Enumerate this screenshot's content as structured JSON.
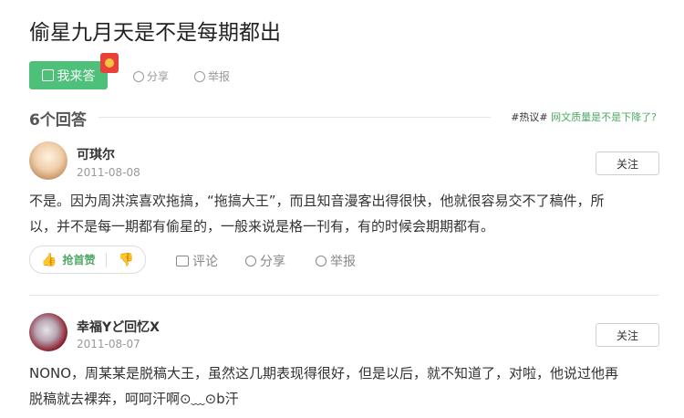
{
  "question": {
    "title": "偷星九月天是不是每期都出"
  },
  "toolbar": {
    "answer_label": "我来答",
    "share_label": "分享",
    "report_label": "举报"
  },
  "answers_header": {
    "count_label": "6个回答",
    "topic_tag": "#热议#",
    "topic_link": "网文质量是不是下降了?"
  },
  "answers": [
    {
      "user": "可琪尔",
      "date": "2011-08-08",
      "follow_label": "关注",
      "text_line1": "不是。因为周洪滨喜欢拖搞，“拖搞大王”，而且知音漫客出得很快，他就很容易交不了稿件，所",
      "text_line2": "以，并不是每一期都有偷星的，一般来说是格一刊有，有的时候会期期都有。",
      "like_label": "抢首赞",
      "comment_label": "评论",
      "share_label": "分享",
      "report_label": "举报"
    },
    {
      "user": "幸福Yど回忆X",
      "date": "2011-08-07",
      "follow_label": "关注",
      "text_line1": "NONO，周某某是脱稿大王，虽然这几期表现得很好，但是以后，就不知道了，对啦，他说过他再",
      "text_line2": "脱稿就去裸奔，呵呵汗啊⊙﹏⊙b汗"
    }
  ],
  "icons": {
    "answer": "edit-icon",
    "share": "share-icon",
    "report": "report-icon",
    "like": "thumbs-up-icon",
    "dislike": "thumbs-down-icon",
    "comment": "comment-icon"
  },
  "colors": {
    "accent_green": "#4ec07a",
    "link_green": "#4ea866"
  }
}
